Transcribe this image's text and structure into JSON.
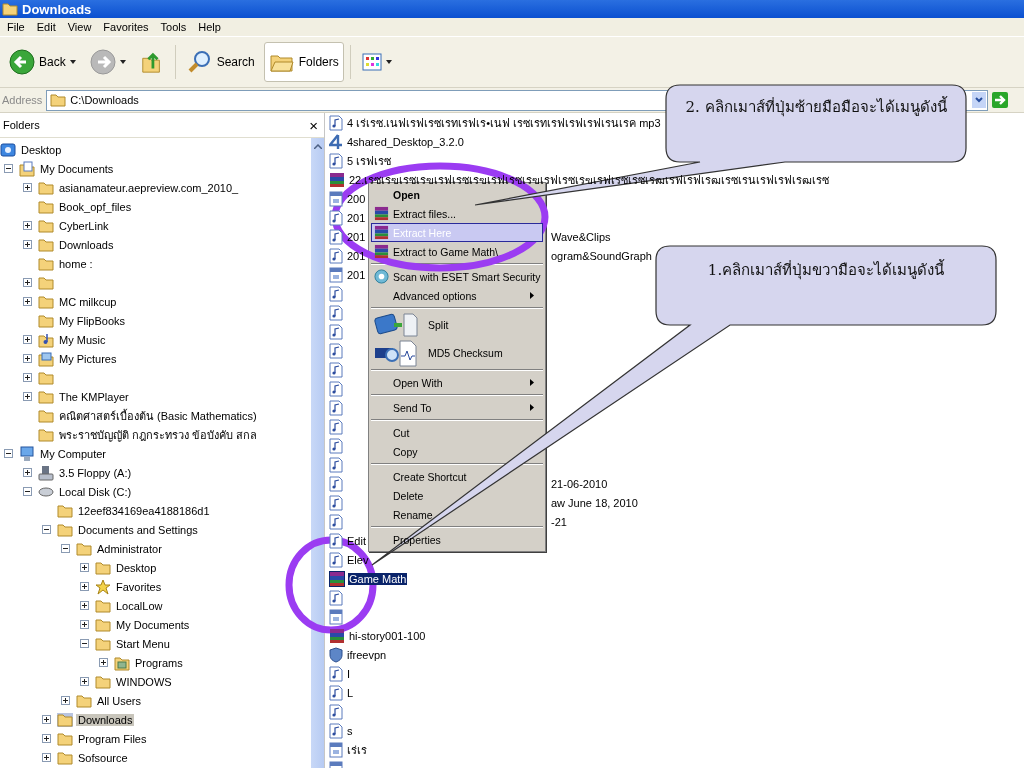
{
  "window": {
    "title": "Downloads"
  },
  "menu_bar": [
    "File",
    "Edit",
    "View",
    "Favorites",
    "Tools",
    "Help"
  ],
  "toolbar": [
    {
      "kind": "back",
      "label": "Back",
      "pressed": false,
      "dropdown": true
    },
    {
      "kind": "forward",
      "pressed": false,
      "dropdown": true
    },
    {
      "kind": "up",
      "pressed": false,
      "dropdown": false
    },
    {
      "kind": "search",
      "label": "Search",
      "pressed": false,
      "dropdown": false
    },
    {
      "kind": "folders",
      "label": "Folders",
      "pressed": true,
      "dropdown": false
    },
    {
      "kind": "views",
      "pressed": false,
      "dropdown": true
    }
  ],
  "address": {
    "label": "Address",
    "value": "C:\\Downloads"
  },
  "folders_pane": {
    "title": "Folders",
    "close": "×",
    "tree": [
      {
        "label": "Desktop",
        "kind": "desktop",
        "selected": false,
        "children": [
          {
            "label": "My Documents",
            "kind": "documents",
            "expanded": true,
            "selected": false,
            "children": [
              {
                "label": "asianamateur.aepreview.com_2010_",
                "kind": "folder",
                "expanded": false,
                "selected": false
              },
              {
                "label": "Book_opf_files",
                "kind": "folder",
                "selected": false
              },
              {
                "label": "CyberLink",
                "kind": "folder",
                "expanded": false,
                "selected": false
              },
              {
                "label": "Downloads",
                "kind": "folder",
                "expanded": false,
                "selected": false
              },
              {
                "label": "home :",
                "kind": "folder",
                "selected": false
              },
              {
                "kind": "folder",
                "expanded": false,
                "selected": false
              },
              {
                "label": "MC milkcup",
                "kind": "folder",
                "expanded": false,
                "selected": false
              },
              {
                "label": "My FlipBooks",
                "kind": "folder",
                "selected": false
              },
              {
                "label": "My Music",
                "kind": "music",
                "expanded": false,
                "selected": false
              },
              {
                "label": "My Pictures",
                "kind": "pictures",
                "expanded": false,
                "selected": false
              },
              {
                "kind": "folder",
                "expanded": false,
                "selected": false
              },
              {
                "label": "The KMPlayer",
                "kind": "folder",
                "expanded": false,
                "selected": false
              },
              {
                "label": "คณิตศาสตร์เบื้องต้น (Basic Mathematics)",
                "kind": "folder",
                "selected": false
              },
              {
                "label": "พระราชบัญญัติ  กฎกระทรวง  ข้อบังคับ สกล",
                "kind": "folder",
                "selected": false
              }
            ]
          },
          {
            "label": "My Computer",
            "kind": "computer",
            "expanded": true,
            "selected": false,
            "children": [
              {
                "label": "3.5 Floppy (A:)",
                "kind": "floppy",
                "expanded": false,
                "selected": false
              },
              {
                "label": "Local Disk (C:)",
                "kind": "disk",
                "expanded": true,
                "selected": false,
                "children": [
                  {
                    "label": "12eef834169ea4188186d1",
                    "kind": "folder",
                    "selected": false
                  },
                  {
                    "label": "Documents and Settings",
                    "kind": "folder",
                    "expanded": true,
                    "selected": false,
                    "children": [
                      {
                        "label": "Administrator",
                        "kind": "folder",
                        "expanded": true,
                        "selected": false,
                        "children": [
                          {
                            "label": "Desktop",
                            "kind": "folder",
                            "expanded": false,
                            "selected": false
                          },
                          {
                            "label": "Favorites",
                            "kind": "star",
                            "expanded": false,
                            "selected": false
                          },
                          {
                            "label": "LocalLow",
                            "kind": "folder",
                            "expanded": false,
                            "selected": false
                          },
                          {
                            "label": "My Documents",
                            "kind": "folder",
                            "expanded": false,
                            "selected": false
                          },
                          {
                            "label": "Start Menu",
                            "kind": "folder",
                            "expanded": true,
                            "selected": false,
                            "children": [
                              {
                                "label": "Programs",
                                "kind": "programs",
                                "expanded": false,
                                "selected": false
                              }
                            ]
                          },
                          {
                            "label": "WINDOWS",
                            "kind": "folder",
                            "expanded": false,
                            "selected": false
                          }
                        ]
                      },
                      {
                        "label": "All Users",
                        "kind": "folder",
                        "expanded": false,
                        "selected": false
                      }
                    ]
                  },
                  {
                    "label": "Downloads",
                    "kind": "folder",
                    "expanded": false,
                    "selected": true
                  },
                  {
                    "label": "Program Files",
                    "kind": "folder",
                    "expanded": false,
                    "selected": false
                  },
                  {
                    "label": "Sofsource",
                    "kind": "folder",
                    "expanded": false,
                    "selected": false
                  }
                ]
              }
            ]
          }
        ]
      }
    ]
  },
  "files": [
    {
      "kind": "audio",
      "text": "4 เร่เรซ.เนฟเรฟเรซเรทเรฟเร•เนฟ เรซเรทเรฟเรฟเรฟเรนเรค mp3",
      "selected": false
    },
    {
      "kind": "app",
      "text": "4shared_Desktop_3.2.0",
      "selected": false
    },
    {
      "kind": "audio",
      "text": "5 เรฟเรซ",
      "selected": false
    },
    {
      "kind": "archive",
      "text": "22.เรซเรฃเรซเรฃเรฟเรซเรฃเรฟเรซเรฃเรฟเรซเรฃเรฟเรซเรซเรฒเรฟเรฟเรฒเรซเรนเรฟเรฟเรฒเรซ",
      "selected": false
    },
    {
      "kind": "doc",
      "text": "200",
      "selected": false
    },
    {
      "kind": "audio",
      "text": "201",
      "selected": false
    },
    {
      "kind": "audio",
      "text": "201",
      "tail": "Wave&Clips",
      "selected": false
    },
    {
      "kind": "audio",
      "text": "201",
      "tail": "ogram&SoundGraph",
      "selected": false
    },
    {
      "kind": "doc",
      "text": "201",
      "selected": false
    },
    {
      "kind": "audio",
      "selected": false
    },
    {
      "kind": "audio",
      "selected": false
    },
    {
      "kind": "audio",
      "selected": false
    },
    {
      "kind": "audio",
      "selected": false
    },
    {
      "kind": "audio",
      "selected": false
    },
    {
      "kind": "audio",
      "selected": false
    },
    {
      "kind": "audio",
      "selected": false
    },
    {
      "kind": "audio",
      "selected": false
    },
    {
      "kind": "audio",
      "selected": false
    },
    {
      "kind": "audio",
      "selected": false
    },
    {
      "kind": "audio",
      "tail": "21-06-2010",
      "selected": false
    },
    {
      "kind": "audio",
      "tail": "aw June 18, 2010",
      "selected": false
    },
    {
      "kind": "audio",
      "tail": "-21",
      "selected": false
    },
    {
      "kind": "audio",
      "text": "Edit",
      "selected": false
    },
    {
      "kind": "audio",
      "text": "Elev",
      "selected": false
    },
    {
      "kind": "archive",
      "text": "Game Math",
      "selected": true
    },
    {
      "kind": "audio",
      "selected": false
    },
    {
      "kind": "doc",
      "selected": false
    },
    {
      "kind": "archive",
      "text": "hi-story001-100",
      "selected": false
    },
    {
      "kind": "vpn",
      "text": "ifreevpn",
      "selected": false
    },
    {
      "kind": "audio",
      "text": "I",
      "selected": false
    },
    {
      "kind": "audio",
      "text": "L",
      "selected": false
    },
    {
      "kind": "audio",
      "selected": false
    },
    {
      "kind": "audio",
      "text": "s",
      "selected": false
    },
    {
      "kind": "doc",
      "text": "เร่เร",
      "selected": false
    },
    {
      "kind": "doc",
      "selected": false
    }
  ],
  "context_menu": [
    {
      "kind": "item",
      "label": "Open",
      "default": true,
      "selected": false
    },
    {
      "kind": "item",
      "label": "Extract files...",
      "default": false,
      "selected": false
    },
    {
      "kind": "item",
      "label": "Extract Here",
      "default": false,
      "selected": true
    },
    {
      "kind": "item",
      "label": "Extract to Game Math\\",
      "default": false,
      "selected": false
    },
    {
      "kind": "separator"
    },
    {
      "kind": "item",
      "label": "Scan with ESET Smart Security",
      "default": false,
      "selected": false
    },
    {
      "kind": "item",
      "label": "Advanced options",
      "submenu": true,
      "default": false,
      "selected": false
    },
    {
      "kind": "separator"
    },
    {
      "kind": "big",
      "label": "Split",
      "default": false,
      "selected": false
    },
    {
      "kind": "big",
      "label": "MD5 Checksum",
      "default": false,
      "selected": false
    },
    {
      "kind": "separator"
    },
    {
      "kind": "item",
      "label": "Open With",
      "submenu": true,
      "default": false,
      "selected": false
    },
    {
      "kind": "separator"
    },
    {
      "kind": "item",
      "label": "Send To",
      "submenu": true,
      "default": false,
      "selected": false
    },
    {
      "kind": "separator"
    },
    {
      "kind": "item",
      "label": "Cut",
      "default": false,
      "selected": false
    },
    {
      "kind": "item",
      "label": "Copy",
      "default": false,
      "selected": false
    },
    {
      "kind": "separator"
    },
    {
      "kind": "item",
      "label": "Create Shortcut",
      "default": false,
      "selected": false
    },
    {
      "kind": "item",
      "label": "Delete",
      "default": false,
      "selected": false
    },
    {
      "kind": "item",
      "label": "Rename",
      "default": false,
      "selected": false
    },
    {
      "kind": "separator"
    },
    {
      "kind": "item",
      "label": "Properties",
      "default": false,
      "selected": false
    }
  ],
  "callouts": [
    {
      "text": "2. คลิกเมาส์ที่ปุ่มซ้ายมือมือจะได้เมนูดังนี้"
    },
    {
      "text": "1.คลิกเมาส์ที่ปุ่มขวามือจะได้เมนูดังนี้"
    }
  ]
}
